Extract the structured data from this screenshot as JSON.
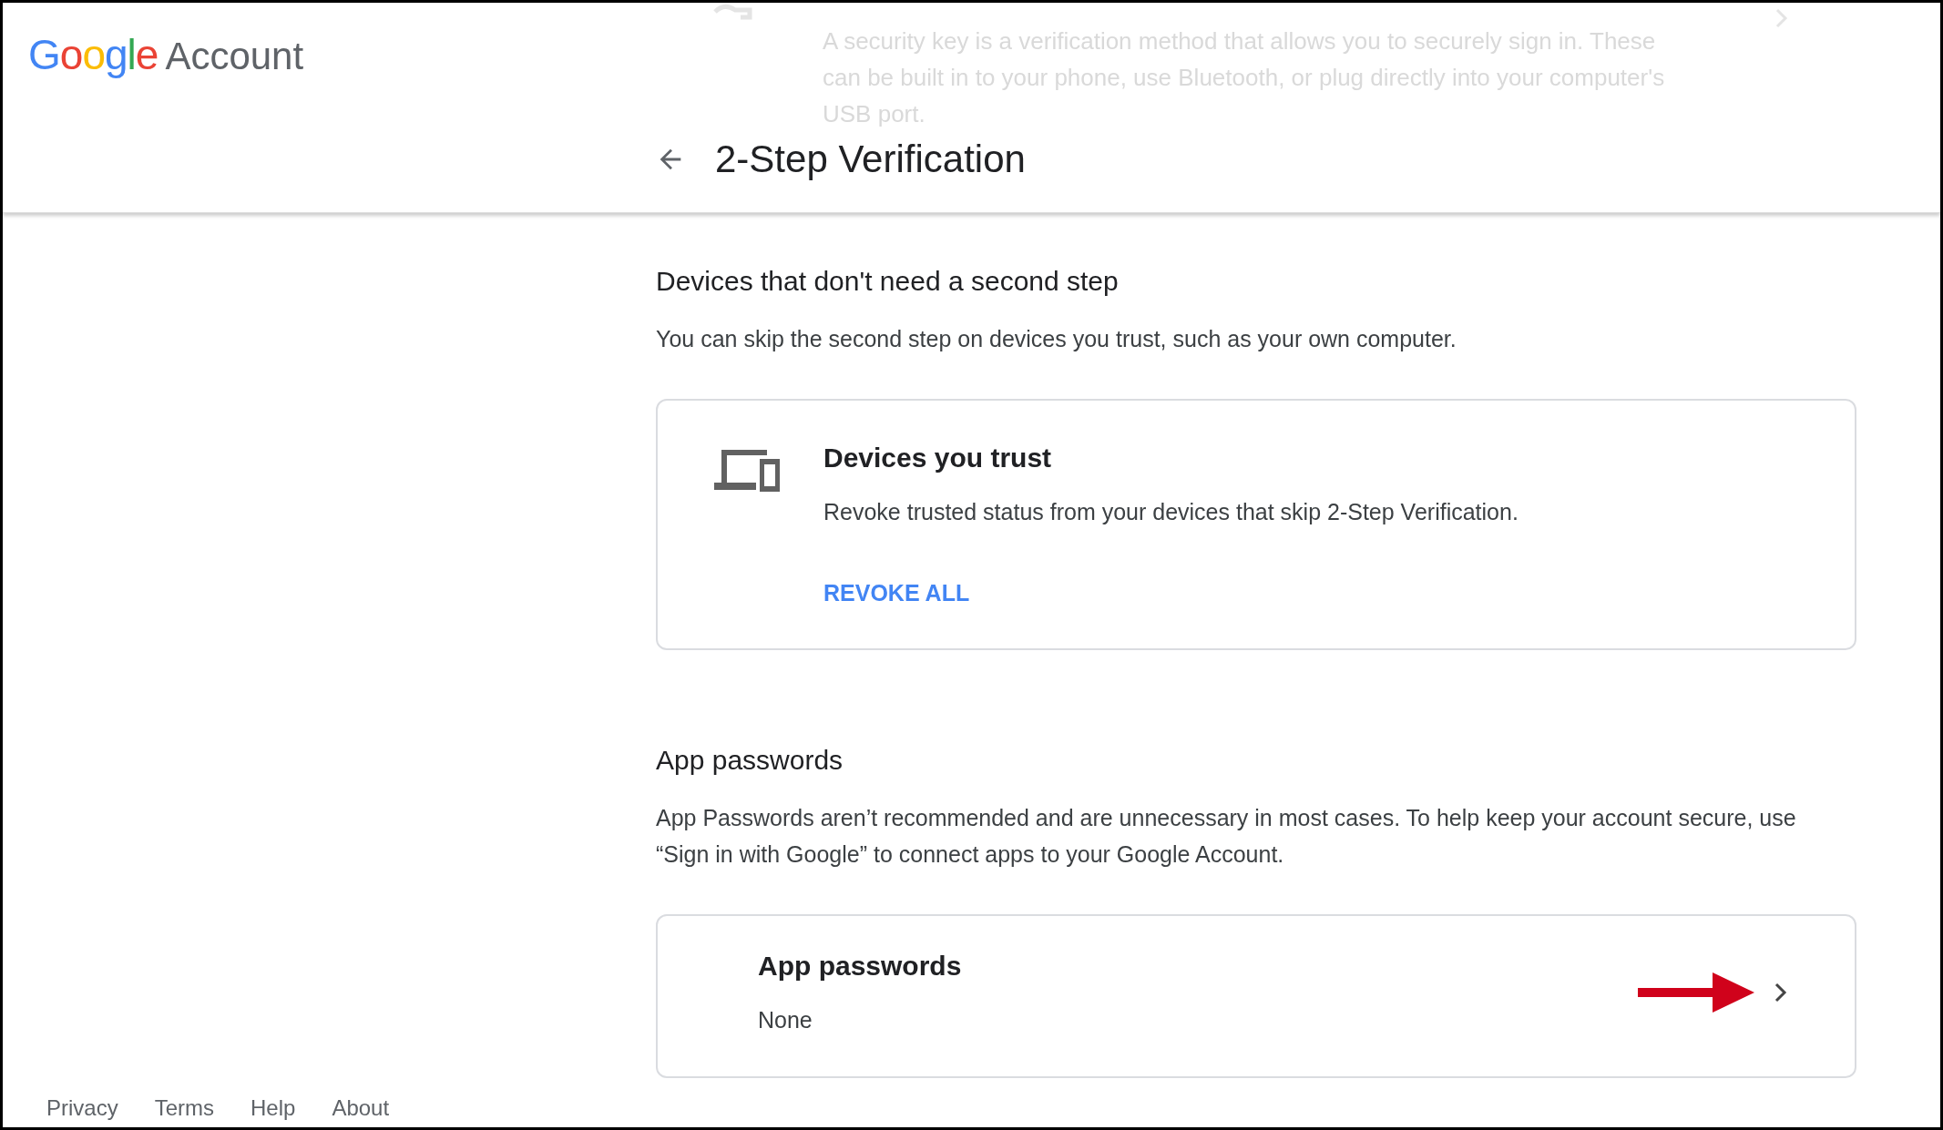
{
  "header": {
    "logo": {
      "brand": "Google",
      "product": "Account"
    },
    "title": "2-Step Verification",
    "behind_text": "A security key is a verification method that allows you to securely sign in. These can be built in to your phone, use Bluetooth, or plug directly into your computer's USB port."
  },
  "sections": [
    {
      "heading": "Devices that don't need a second step",
      "description": "You can skip the second step on devices you trust, such as your own computer.",
      "card": {
        "kind": "devices",
        "title": "Devices you trust",
        "text": "Revoke trusted status from your devices that skip 2-Step Verification.",
        "action": "REVOKE ALL"
      }
    },
    {
      "heading": "App passwords",
      "description": "App Passwords aren’t recommended and are unnecessary in most cases. To help keep your account secure, use “Sign in with Google” to connect apps to your Google Account.",
      "card": {
        "kind": "link",
        "title": "App passwords",
        "text": "None"
      }
    }
  ],
  "footer": [
    "Privacy",
    "Terms",
    "Help",
    "About"
  ]
}
